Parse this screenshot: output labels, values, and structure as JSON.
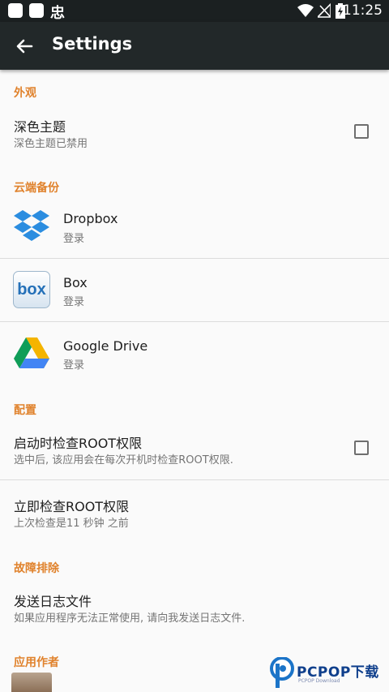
{
  "status_bar": {
    "icon_glyph": "忠",
    "time": "11:25"
  },
  "toolbar": {
    "title": "Settings"
  },
  "sections": {
    "appearance": {
      "header": "外观",
      "dark_theme": {
        "title": "深色主题",
        "subtitle": "深色主题已禁用"
      }
    },
    "cloud_backup": {
      "header": "云端备份",
      "dropbox": {
        "title": "Dropbox",
        "subtitle": "登录"
      },
      "box": {
        "title": "Box",
        "subtitle": "登录",
        "icon_text": "box"
      },
      "google_drive": {
        "title": "Google Drive",
        "subtitle": "登录"
      }
    },
    "config": {
      "header": "配置",
      "root_check_on_start": {
        "title": "启动时检查ROOT权限",
        "subtitle": "选中后, 该应用会在每次开机时检查ROOT权限."
      },
      "root_check_now": {
        "title": "立即检查ROOT权限",
        "subtitle": "上次检查是11 秒钟 之前"
      }
    },
    "troubleshooting": {
      "header": "故障排除",
      "send_log": {
        "title": "发送日志文件",
        "subtitle": "如果应用程序无法正常使用, 请向我发送日志文件."
      }
    },
    "author": {
      "header": "应用作者"
    }
  },
  "watermark": {
    "brand": "PCPOP下载",
    "sub": "PCPOP Download"
  },
  "colors": {
    "accent": "#e0822c",
    "toolbar": "#222829",
    "statusbar": "#1b2021"
  }
}
